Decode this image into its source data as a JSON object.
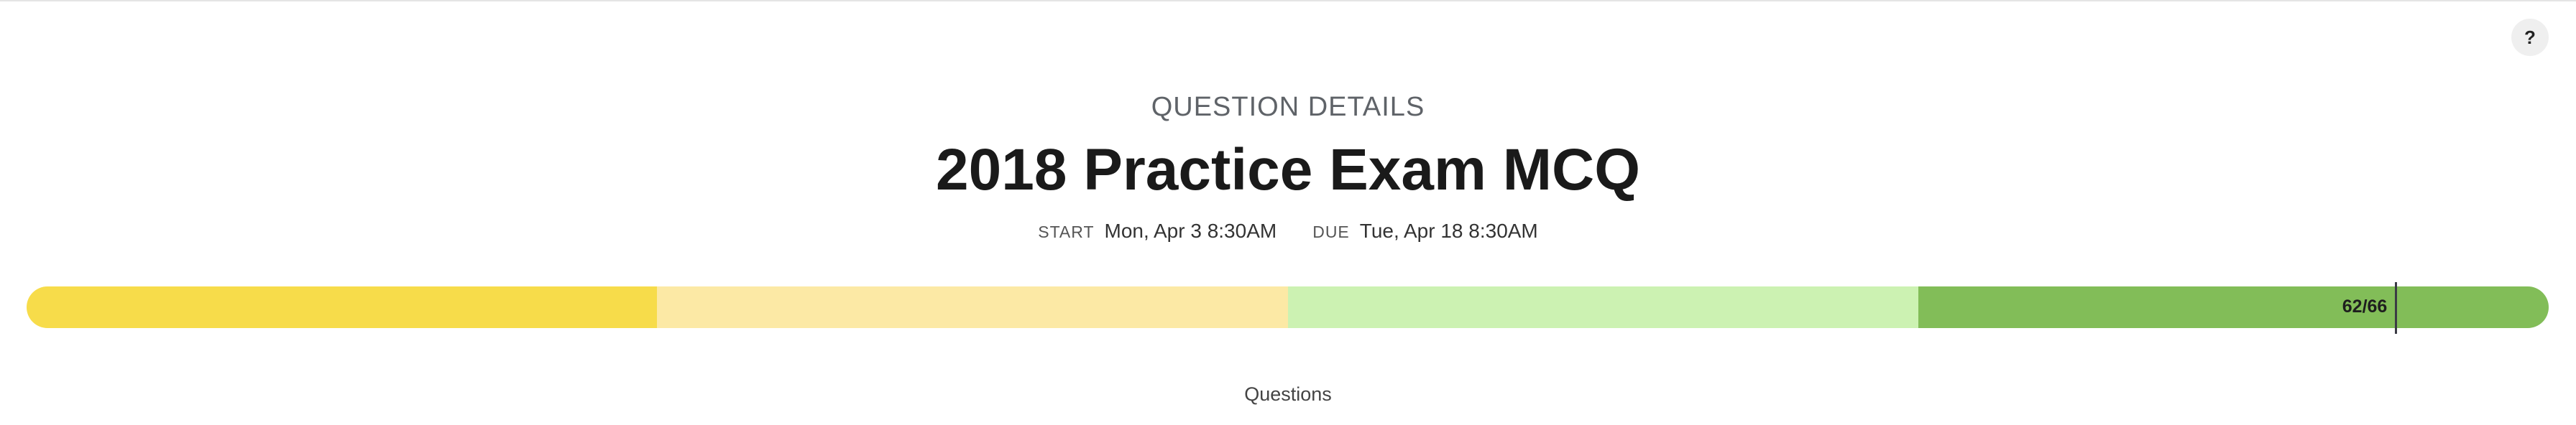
{
  "header": {
    "help_label": "?",
    "subtitle": "QUESTION DETAILS",
    "title": "2018 Practice Exam MCQ"
  },
  "dates": {
    "start_key": "START",
    "start_value": "Mon, Apr 3 8:30AM",
    "due_key": "DUE",
    "due_value": "Tue, Apr 18 8:30AM"
  },
  "progress": {
    "segments": [
      {
        "color": "#f7dc4a",
        "fraction": 0.25
      },
      {
        "color": "#fce9a5",
        "fraction": 0.25
      },
      {
        "color": "#ccf2b2",
        "fraction": 0.25
      },
      {
        "color": "#82bd58",
        "fraction": 0.25
      }
    ],
    "completed": 62,
    "total": 66,
    "label": "62/66"
  },
  "footer": {
    "questions_label": "Questions"
  }
}
